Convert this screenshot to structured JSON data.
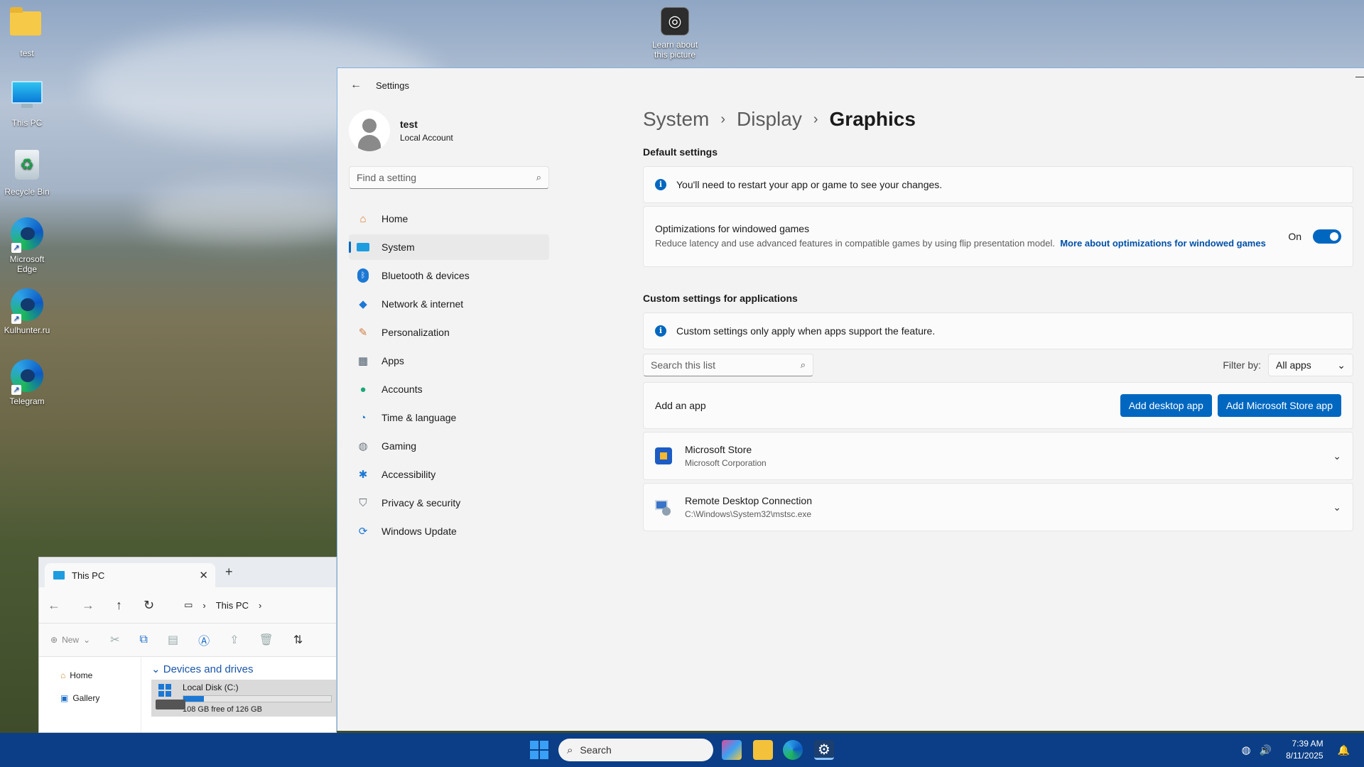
{
  "desktop": {
    "icons": [
      {
        "label": "test"
      },
      {
        "label": "This PC"
      },
      {
        "label": "Recycle Bin"
      },
      {
        "label": "Microsoft Edge"
      },
      {
        "label": "Kulhunter.ru"
      },
      {
        "label": "Telegram"
      }
    ],
    "learn_about": "Learn about this picture"
  },
  "explorer": {
    "tab_title": "This PC",
    "address": "This PC",
    "toolbar_new": "New",
    "sidebar": [
      {
        "label": "Home"
      },
      {
        "label": "Gallery"
      }
    ],
    "group": "Devices and drives",
    "drive": {
      "name": "Local Disk (C:)",
      "free_text": "108 GB free of 126 GB",
      "used_fraction": 0.14
    }
  },
  "settings": {
    "window_title": "Settings",
    "account": {
      "name": "test",
      "type": "Local Account"
    },
    "find_placeholder": "Find a setting",
    "nav": [
      {
        "label": "Home",
        "icon": "home-icon"
      },
      {
        "label": "System",
        "icon": "system-icon",
        "selected": true
      },
      {
        "label": "Bluetooth & devices",
        "icon": "bluetooth-icon"
      },
      {
        "label": "Network & internet",
        "icon": "wifi-icon"
      },
      {
        "label": "Personalization",
        "icon": "brush-icon"
      },
      {
        "label": "Apps",
        "icon": "apps-icon"
      },
      {
        "label": "Accounts",
        "icon": "account-icon"
      },
      {
        "label": "Time & language",
        "icon": "clock-globe-icon"
      },
      {
        "label": "Gaming",
        "icon": "gamepad-icon"
      },
      {
        "label": "Accessibility",
        "icon": "accessibility-icon"
      },
      {
        "label": "Privacy & security",
        "icon": "shield-icon"
      },
      {
        "label": "Windows Update",
        "icon": "update-icon"
      }
    ],
    "breadcrumb": [
      "System",
      "Display",
      "Graphics"
    ],
    "default_section": "Default settings",
    "restart_notice": "You'll need to restart your app or game to see your changes.",
    "optimizations": {
      "title": "Optimizations for windowed games",
      "description": "Reduce latency and use advanced features in compatible games by using flip presentation model.",
      "link": "More about optimizations for windowed games",
      "state_label": "On"
    },
    "custom_section": "Custom settings for applications",
    "custom_notice": "Custom settings only apply when apps support the feature.",
    "search_placeholder": "Search this list",
    "filter_label": "Filter by:",
    "filter_value": "All apps",
    "add_app_label": "Add an app",
    "add_desktop_button": "Add desktop app",
    "add_store_button": "Add Microsoft Store app",
    "apps": [
      {
        "name": "Microsoft Store",
        "sub": "Microsoft Corporation"
      },
      {
        "name": "Remote Desktop Connection",
        "sub": "C:\\Windows\\System32\\mstsc.exe"
      }
    ]
  },
  "taskbar": {
    "search_label": "Search",
    "time": "7:39 AM",
    "date": "8/11/2025"
  },
  "colors": {
    "accent": "#0067c0",
    "taskbar": "#0b3e86"
  }
}
